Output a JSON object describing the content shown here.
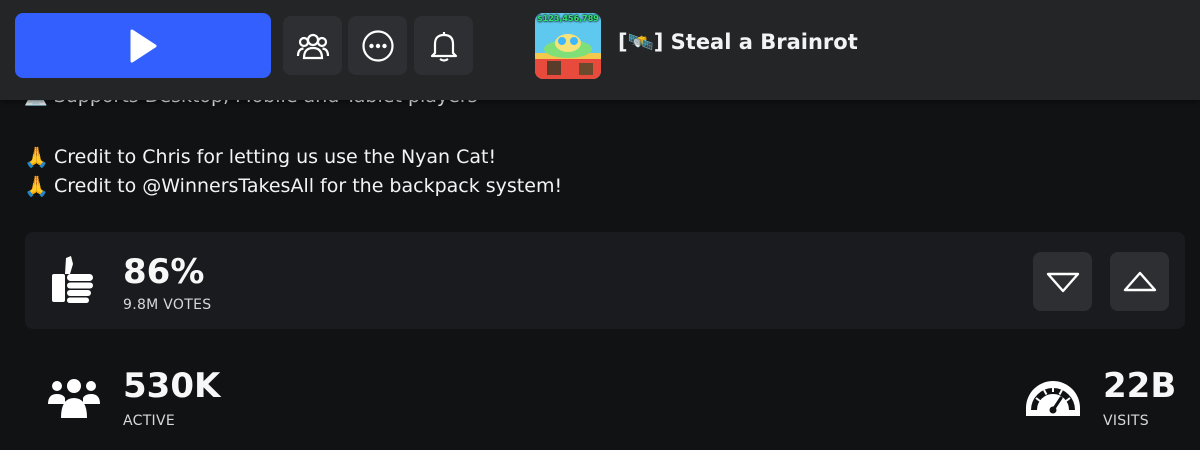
{
  "header": {
    "play_button_label": "",
    "play_icon": "play-icon",
    "friends_icon": "friends-icon",
    "more_icon": "more-icon",
    "notifications_icon": "bell-icon",
    "game_title": "[🛰️] Steal a Brainrot",
    "thumbnail_text": "$123,456,789"
  },
  "description": {
    "clipped_line": "💻 Supports Desktop, Mobile and Tablet players",
    "credits": [
      "Credit to Chris for letting us use the Nyan Cat!",
      "Credit to @WinnersTakesAll for the backpack system!"
    ],
    "credit_emoji": "🙏"
  },
  "votes": {
    "percent": "86%",
    "count_label": "9.8M VOTES"
  },
  "stats": {
    "active_value": "530K",
    "active_label": "ACTIVE",
    "visits_value": "22B",
    "visits_label": "VISITS"
  },
  "colors": {
    "play_button": "#335fff",
    "topbar_bg": "#232527",
    "page_bg": "#111214",
    "card_bg": "#1a1b1e"
  }
}
